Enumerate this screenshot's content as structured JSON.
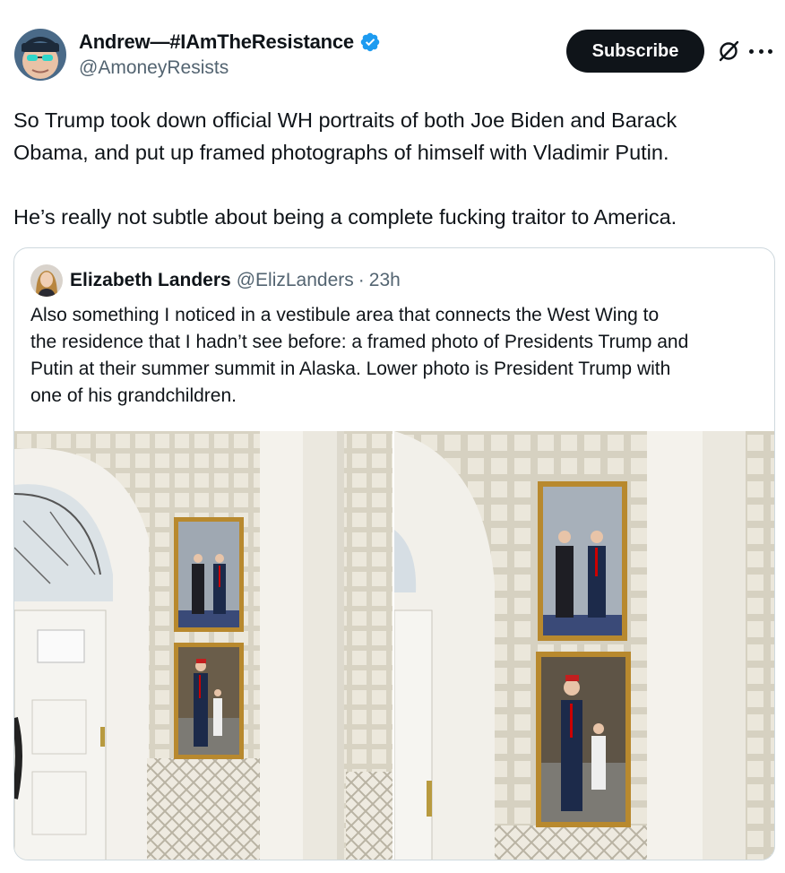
{
  "post": {
    "author": {
      "display_name": "Andrew—#IAmTheResistance",
      "handle": "@AmoneyResists",
      "verified": true
    },
    "subscribe_label": "Subscribe",
    "icons": [
      "verified-badge-icon",
      "grok-icon",
      "more-options-icon"
    ],
    "text_lines": [
      "So Trump took down official WH portraits of both Joe Biden and Barack",
      "Obama, and put up framed photographs of himself with Vladimir Putin.",
      "He’s really not subtle about being a complete fucking traitor to America."
    ]
  },
  "quote": {
    "author": {
      "display_name": "Elizabeth Landers",
      "handle": "@ElizLanders",
      "separator": "·",
      "time": "23h"
    },
    "text_lines": [
      "Also something I noticed in a vestibule area that connects the West Wing to",
      "the residence that I hadn’t see before: a framed photo of Presidents Trump and",
      "Putin at their summer summit in Alaska. Lower photo is President Trump with",
      "one of his grandchildren."
    ],
    "media_count": 2
  },
  "colors": {
    "text_primary": "#0f1419",
    "text_secondary": "#536471",
    "verified_blue": "#1d9bf0",
    "border": "#cfd9de",
    "button_bg": "#0f1419"
  }
}
